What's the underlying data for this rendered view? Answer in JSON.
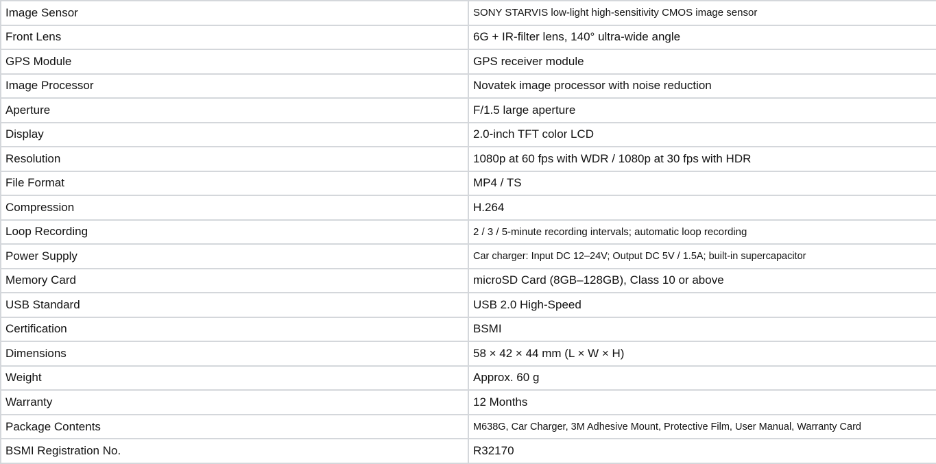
{
  "specs": [
    {
      "label": "Image Sensor",
      "value": "SONY STARVIS low-light high-sensitivity CMOS image sensor"
    },
    {
      "label": "Front Lens",
      "value": "6G + IR-filter lens, 140° ultra-wide angle"
    },
    {
      "label": "GPS Module",
      "value": "GPS receiver module"
    },
    {
      "label": "Image Processor",
      "value": "Novatek image processor with noise reduction"
    },
    {
      "label": "Aperture",
      "value": "F/1.5 large aperture"
    },
    {
      "label": "Display",
      "value": "2.0-inch TFT color LCD"
    },
    {
      "label": "Resolution",
      "value": "1080p at 60 fps with WDR / 1080p at 30 fps with HDR"
    },
    {
      "label": "File Format",
      "value": "MP4 / TS"
    },
    {
      "label": "Compression",
      "value": "H.264"
    },
    {
      "label": "Loop Recording",
      "value": "2 / 3 / 5-minute recording intervals; automatic loop recording"
    },
    {
      "label": "Power Supply",
      "value": "Car charger: Input DC 12–24V; Output DC 5V / 1.5A; built-in supercapacitor"
    },
    {
      "label": "Memory Card",
      "value": "microSD Card (8GB–128GB), Class 10 or above"
    },
    {
      "label": "USB Standard",
      "value": "USB 2.0 High-Speed"
    },
    {
      "label": "Certification",
      "value": "BSMI"
    },
    {
      "label": "Dimensions",
      "value": "58 × 42 × 44 mm (L × W × H)"
    },
    {
      "label": "Weight",
      "value": "Approx. 60 g"
    },
    {
      "label": "Warranty",
      "value": "12 Months"
    },
    {
      "label": "Package Contents",
      "value": "M638G, Car Charger, 3M Adhesive Mount, Protective Film, User Manual, Warranty Card"
    },
    {
      "label": "BSMI Registration No.",
      "value": "R32170"
    }
  ]
}
